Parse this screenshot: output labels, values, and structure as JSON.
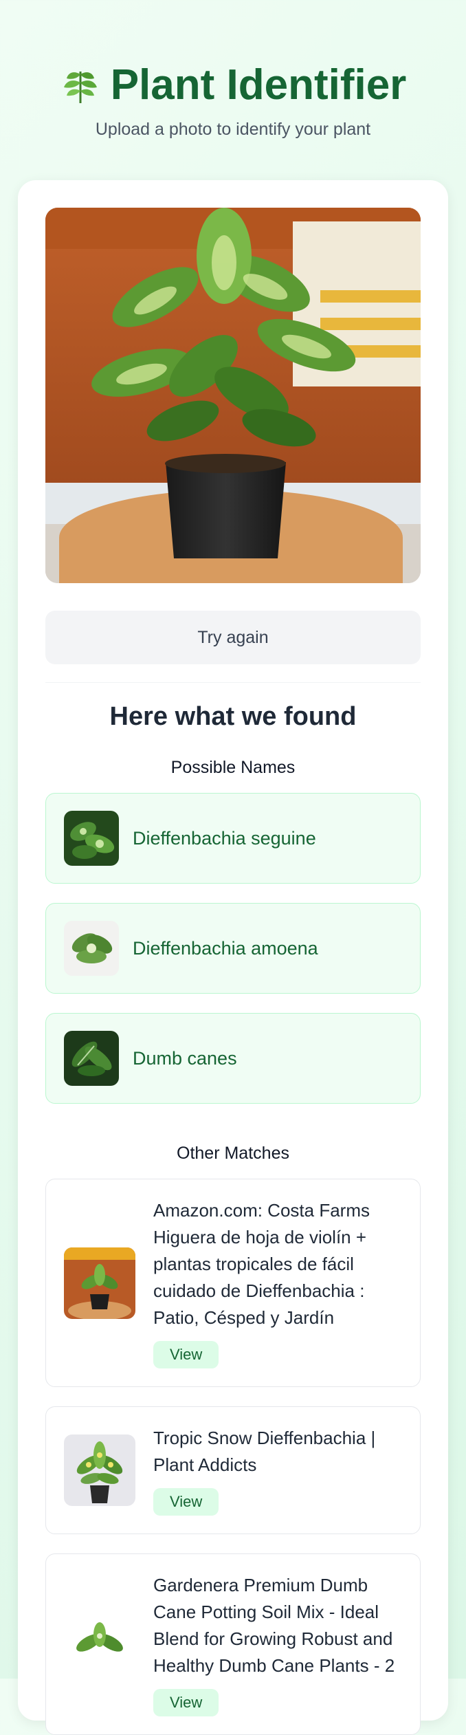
{
  "header": {
    "icon": "leaf-icon",
    "title": "Plant Identifier",
    "subtitle": "Upload a photo to identify your plant"
  },
  "upload": {
    "photo_alt": "dieffenbachia plant in black pot",
    "try_again_label": "Try again"
  },
  "results": {
    "title": "Here what we found",
    "possible_names_label": "Possible Names",
    "possible_names": [
      {
        "name": "Dieffenbachia seguine"
      },
      {
        "name": "Dieffenbachia amoena"
      },
      {
        "name": "Dumb canes"
      }
    ],
    "other_matches_label": "Other Matches",
    "other_matches": [
      {
        "title": "Amazon.com: Costa Farms Higuera de hoja de violín + plantas tropicales de fácil cuidado de Dieffenbachia : Patio, Césped y Jardín",
        "button": "View"
      },
      {
        "title": "Tropic Snow Dieffenbachia | Plant Addicts",
        "button": "View"
      },
      {
        "title": "Gardenera Premium Dumb Cane Potting Soil Mix - Ideal Blend for Growing Robust and Healthy Dumb Cane Plants - 2",
        "button": "View"
      }
    ]
  },
  "colors": {
    "accent": "#166534",
    "name_bg": "#f0fdf4",
    "name_border": "#bbf7d0",
    "button_bg": "#f3f4f6"
  }
}
